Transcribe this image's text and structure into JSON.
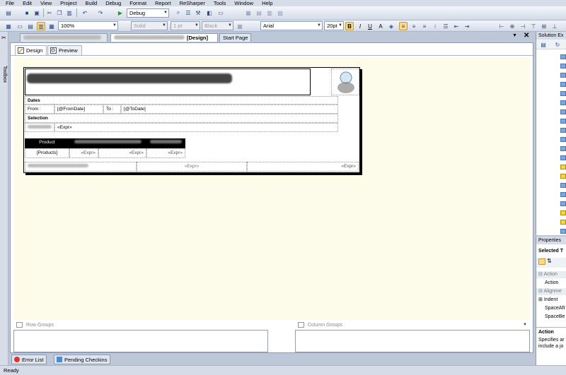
{
  "menu": [
    "File",
    "Edit",
    "View",
    "Project",
    "Build",
    "Debug",
    "Format",
    "Report",
    "ReSharper",
    "Tools",
    "Window",
    "Help"
  ],
  "toolbar1": {
    "config_value": "Debug"
  },
  "toolbar2": {
    "zoom_value": "100%",
    "border_style": "Solid",
    "border_width": "1 pt",
    "border_color": "Black",
    "font_name": "Arial",
    "font_size": "20pt",
    "bold": "B",
    "italic": "I",
    "underline": "U"
  },
  "toolbox": {
    "label": "Toolbox"
  },
  "doc_tabs": [
    {
      "label": "[Design]",
      "active": true
    },
    {
      "label": "Start Page",
      "active": false
    }
  ],
  "view_tabs": [
    {
      "label": "Design",
      "active": true
    },
    {
      "label": "Preview",
      "active": false
    }
  ],
  "report": {
    "dates_label": "Dates",
    "from_label": "From :",
    "from_value": "[@FromDate]",
    "to_label": "To :",
    "to_value": "[@ToDate]",
    "selection_label": "Selection",
    "selection_value": "«Expr»",
    "table_header_1": "Product",
    "table_row": [
      "[Products]",
      "«Expr»",
      "«Expr»",
      "«Expr»"
    ],
    "footer_values": [
      "«Expr»",
      "«Expr»"
    ]
  },
  "groups": {
    "row_label": "Row Groups",
    "column_label": "Column Groups"
  },
  "bottom_tabs": [
    "Error List",
    "Pending Checkins"
  ],
  "status": "Ready",
  "solution": {
    "title": "Solution Ex"
  },
  "properties": {
    "title": "Properties",
    "selected": "Selected T",
    "items": [
      "Action",
      "Action",
      "Alignme",
      "Indent",
      "SpaceAft",
      "SpaceBe"
    ],
    "desc_title": "Action",
    "desc_text": [
      "Specifies ar",
      "include a jo"
    ]
  },
  "colors": {
    "canvas": "#fdfbe9",
    "chrome": "#bcc7d8",
    "accent": "#fbd98a"
  }
}
